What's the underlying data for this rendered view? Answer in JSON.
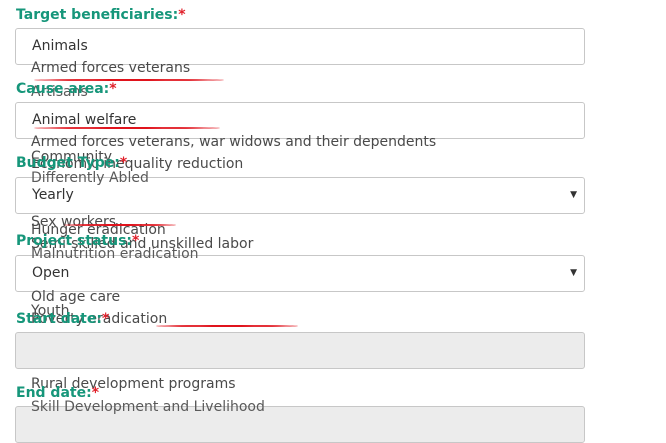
{
  "target_beneficiaries": {
    "label": "Target beneficiaries:",
    "required": "*",
    "value": "Animals"
  },
  "cause_area": {
    "label": "Cause area:",
    "required": "*",
    "value": "Animal welfare"
  },
  "budget_type": {
    "label": "Budget Type:",
    "required": "*",
    "value": "Yearly"
  },
  "project_status": {
    "label": "Project status:",
    "required": "*",
    "value": "Open"
  },
  "start_date": {
    "label": "Start date:",
    "required": "*",
    "value": ""
  },
  "end_date": {
    "label": "End date:",
    "required": "*",
    "value": ""
  },
  "dropdown_ghost_items": [
    "Armed forces veterans",
    "Artisans",
    "Armed forces veterans, war widows and their dependents",
    "Community",
    "Economic inequality reduction",
    "Differently Abled",
    "Sex workers",
    "Hunger eradication",
    "Semi-skilled and unskilled labor",
    "Malnutrition eradication",
    "Old age care",
    "Youth",
    "Poverty eradication",
    "Rural development programs",
    "Skill Development and Livelihood"
  ],
  "icons": {
    "select_caret": "chevron-down-icon"
  },
  "colors": {
    "label": "#16967a",
    "required": "#e0202a",
    "annotation": "#e0131c"
  }
}
